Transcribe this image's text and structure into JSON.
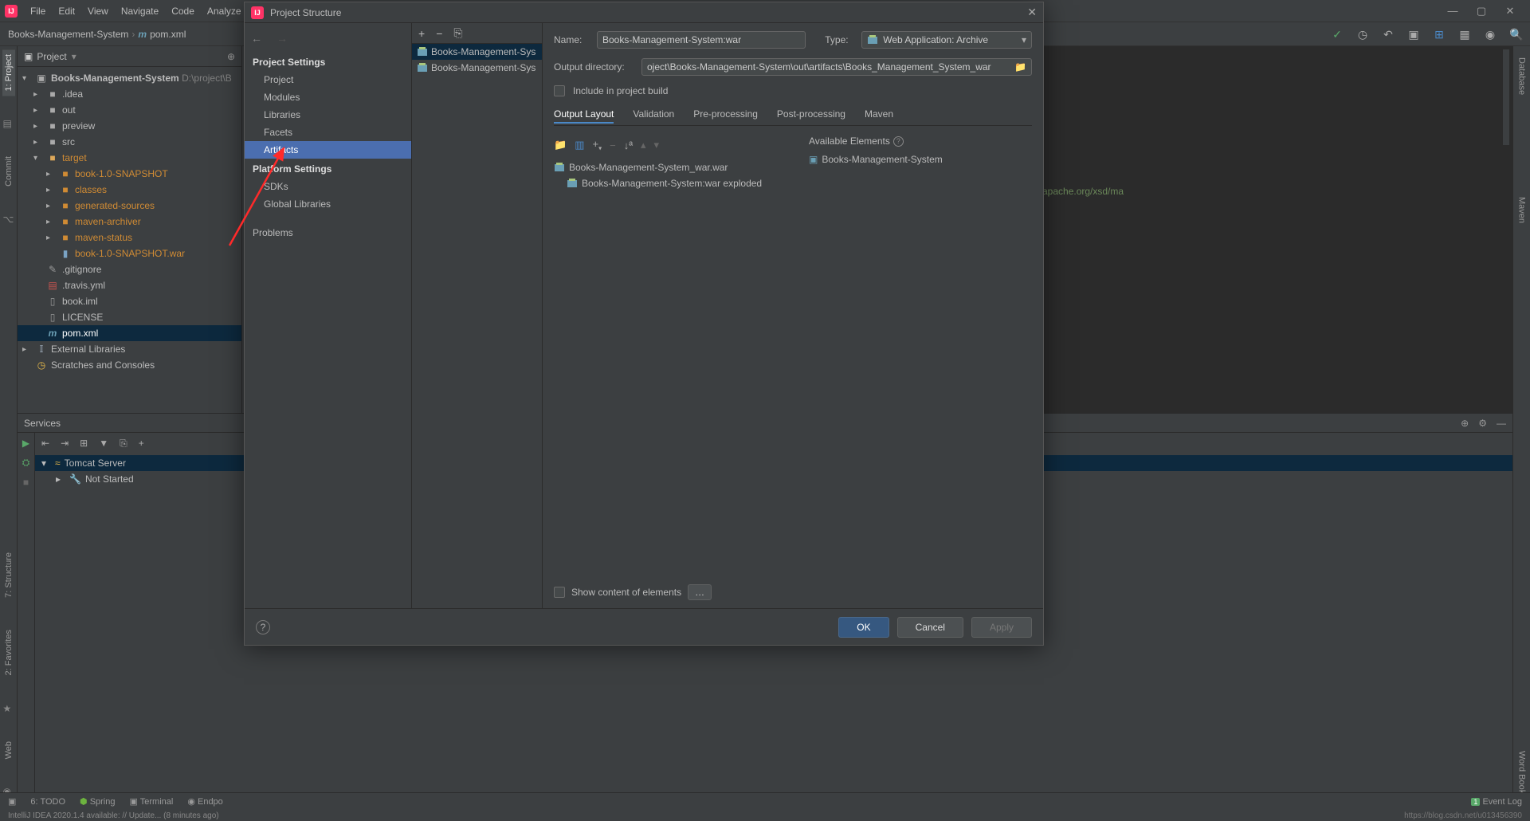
{
  "menubar": {
    "items": [
      "File",
      "Edit",
      "View",
      "Navigate",
      "Code",
      "Analyze"
    ]
  },
  "breadcrumb": {
    "project": "Books-Management-System",
    "file": "pom.xml"
  },
  "projectPanel": {
    "header": "Project",
    "root": "Books-Management-System",
    "rootPath": "D:\\project\\B",
    "folders": {
      "idea": ".idea",
      "out": "out",
      "preview": "preview",
      "src": "src",
      "target": "target",
      "snapshot": "book-1.0-SNAPSHOT",
      "classes": "classes",
      "generated": "generated-sources",
      "archiver": "maven-archiver",
      "status": "maven-status",
      "war": "book-1.0-SNAPSHOT.war"
    },
    "files": {
      "gitignore": ".gitignore",
      "travis": ".travis.yml",
      "iml": "book.iml",
      "license": "LICENSE",
      "pom": "pom.xml"
    },
    "extLib": "External Libraries",
    "scratches": "Scratches and Consoles"
  },
  "services": {
    "title": "Services",
    "tomcat": "Tomcat Server",
    "notStarted": "Not Started"
  },
  "bottombar": {
    "todo": "6: TODO",
    "spring": "Spring",
    "terminal": "Terminal",
    "endpoints": "Endpo",
    "eventlog": "Event Log"
  },
  "statusline": {
    "msg": "IntelliJ IDEA 2020.1.4 available: // Update... (8 minutes ago)",
    "url": "https://blog.csdn.net/u013456390"
  },
  "dialog": {
    "title": "Project Structure",
    "sections": {
      "ps": "Project Settings",
      "project": "Project",
      "modules": "Modules",
      "libraries": "Libraries",
      "facets": "Facets",
      "artifacts": "Artifacts",
      "pls": "Platform Settings",
      "sdks": "SDKs",
      "globlib": "Global Libraries",
      "problems": "Problems"
    },
    "midList": [
      "Books-Management-Sys",
      "Books-Management-Sys"
    ],
    "form": {
      "nameLabel": "Name:",
      "nameValue": "Books-Management-System:war",
      "typeLabel": "Type:",
      "typeValue": "Web Application: Archive",
      "outDirLabel": "Output directory:",
      "outDirValue": "oject\\Books-Management-System\\out\\artifacts\\Books_Management_System_war",
      "includeLabel": "Include in project build"
    },
    "tabs": [
      "Output Layout",
      "Validation",
      "Pre-processing",
      "Post-processing",
      "Maven"
    ],
    "layout": {
      "root": "Books-Management-System_war.war",
      "child": "Books-Management-System:war exploded",
      "aeTitle": "Available Elements",
      "aeItem": "Books-Management-System"
    },
    "showContent": "Show content of elements",
    "buttons": {
      "ok": "OK",
      "cancel": "Cancel",
      "apply": "Apply"
    }
  },
  "editor": {
    "fragment": "apache.org/xsd/ma"
  }
}
